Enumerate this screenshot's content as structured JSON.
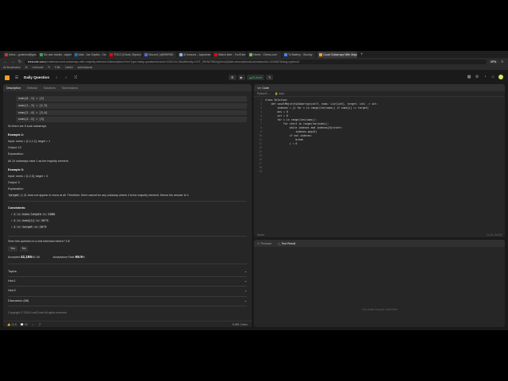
{
  "browser": {
    "tabs": [
      {
        "label": "Inbox - gunkhosl@gmail.com",
        "color": "#d93025"
      },
      {
        "label": "Etc war results - algorithm_p",
        "color": "#34a853"
      },
      {
        "label": "Mail - Jan Szptko - Outlook",
        "color": "#0078d4"
      },
      {
        "label": "TOCO (Ghost, Mysion) - YouTube",
        "color": "#ff0000"
      },
      {
        "label": "Discord | @BRIRNS",
        "color": "#5865f2"
      },
      {
        "label": "AI lessons - Japanese Vocabul",
        "color": "#8ab4f8"
      },
      {
        "label": "Watch later - YouTube",
        "color": "#ff0000"
      },
      {
        "label": "Home - Chess.com",
        "color": "#81b64c"
      },
      {
        "label": "To Battery - Skooby",
        "color": "#4285f4"
      },
      {
        "label": "Count Subarrays With Majority",
        "color": "#f89f1b",
        "active": true
      }
    ],
    "url_host": "leetcode.com",
    "url_path": "/problems/count-subarrays-with-majority-element-ii/description/?envType=daily-question&envId=2026-04-15&difficulty=HOT_50HWTBDAgSmoQ&tab=description&submissionId=1234567&lang=python3",
    "vpn_label": "VPN",
    "bookmarks": [
      "All Bookmarks",
      "M",
      "Leetcode",
      "R",
      "9 life",
      "Useful",
      "submissions"
    ]
  },
  "leetcode": {
    "nav_title": "Daily Question",
    "run_label": "Run",
    "submit_label": "Submit",
    "left_tabs": [
      "Description",
      "Editorial",
      "Solutions",
      "Submissions"
    ],
    "top_lines": [
      "nums[0..2] = [2]",
      "nums[1..3] = [2,3]",
      "nums[2..4] = [3,4]",
      "nums[4..5] = [3]"
    ],
    "there_are": "So there are 5 such subarrays.",
    "example2": {
      "heading": "Example 2:",
      "input": "Input: nums = [1,1,1,1], target = 1",
      "output": "Output: 10",
      "explanation_label": "Explanation:",
      "explanation": "All 10 subarrays have 1 as the majority element."
    },
    "example3": {
      "heading": "Example 3:",
      "input": "Input: nums = [1,2,3], target = 4",
      "output": "Output: 0",
      "explanation_label": "Explanation:",
      "explanation_code": "target = 4",
      "explanation_rest": "does not appear in nums at all. Therefore, there cannot be any subarray where 4 is the majority element. Hence the answer is 0."
    },
    "constraints_heading": "Constraints:",
    "constraints": [
      "1 <= nums.length <= 1000",
      "1 <= nums[i] <= 10^9",
      "1 <= target <= 10^9"
    ],
    "interview_q": "Seen this question in a real interview before?",
    "interview_count": "1/5",
    "yes_label": "Yes",
    "no_label": "No",
    "accepted_label": "Accepted",
    "accepted_value": "42,185",
    "accepted_total": "/61.4K",
    "rate_label": "Acceptance Rate",
    "rate_value": "69.9",
    "rate_unit": "%",
    "accordions": [
      "Topics",
      "Hint 1",
      "Hint 2",
      "Discussion (68)"
    ],
    "copyright": "Copyright © 2026 LeetCode All rights reserved",
    "left_footer": {
      "likes": "12.8",
      "comments": "53",
      "online": "8,988 Online"
    },
    "code_header": "Code",
    "lang": "Python3",
    "auto": "Auto",
    "code_lines": [
      "class Solution:",
      "    def countMajoritySubarrays(self, nums: List[int], target: int) -> int:",
      "        indexes = [i for i in range(len(nums)) if nums[i] == target]",
      "        ans = 0",
      "        cnt = 0",
      "        for i in range(len(nums)):",
      "            for start in range(len(nums)):",
      "                while indexes and indexes[0]<start:",
      "                    indexes.pop(0)",
      "                if not indexes:",
      "                    break",
      "                j = 0",
      "",
      "",
      "",
      "",
      "",
      "",
      ""
    ],
    "code_status": "Saved",
    "code_pos": "Ln 14, Col 13",
    "result_tabs": [
      "Testcase",
      "Test Result"
    ],
    "result_msg": "You must run your code first"
  }
}
